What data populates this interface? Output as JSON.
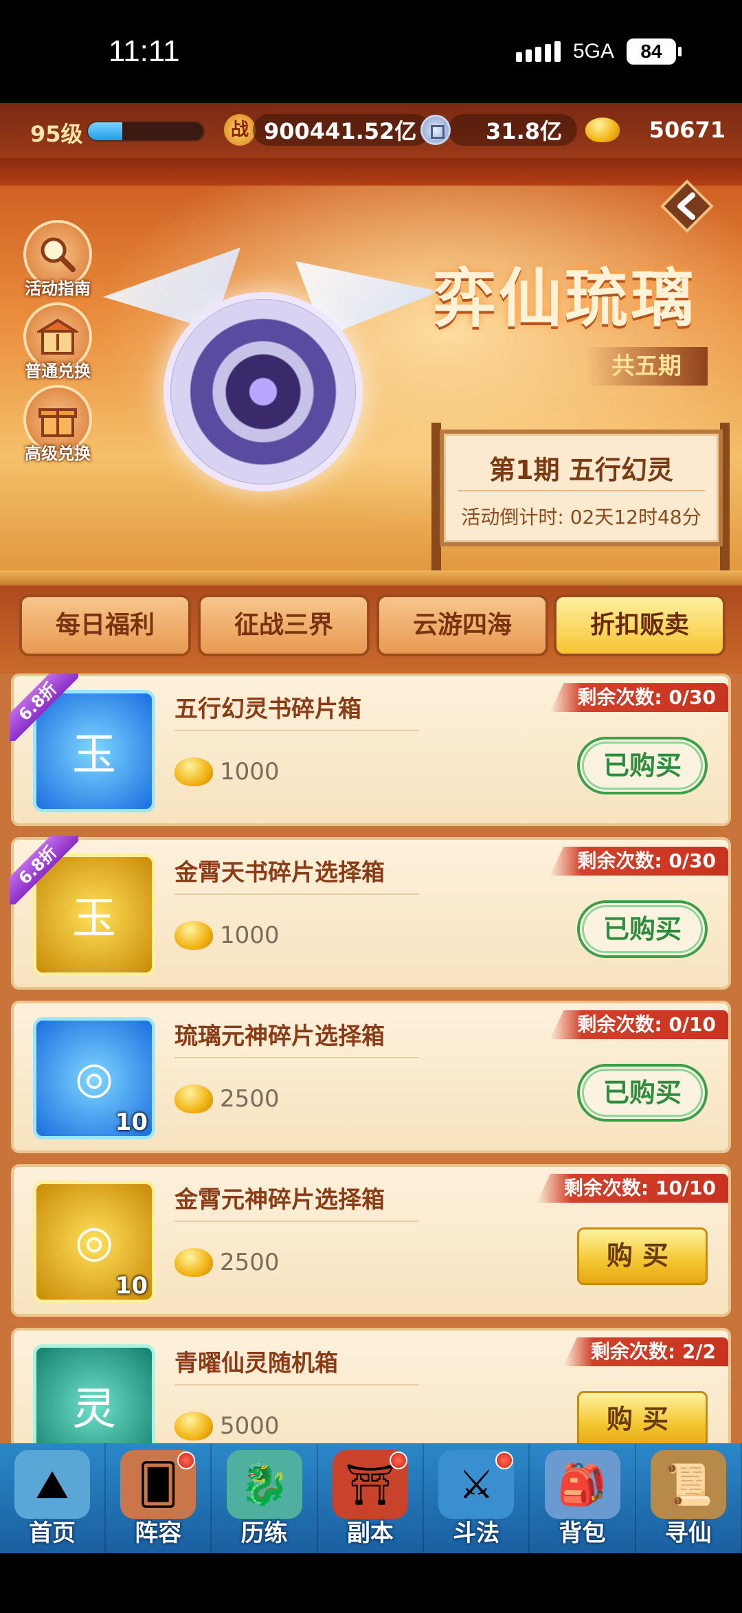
{
  "status": {
    "time": "11:11",
    "network": "5GA",
    "battery": "84"
  },
  "resources": {
    "level": "95级",
    "xp_fraction": 0.3,
    "combat_icon": "战",
    "combat_power": "900441.52亿",
    "silver": "31.8亿",
    "gold": "50671"
  },
  "banner": {
    "title": "弈仙琉璃",
    "subtitle": "共五期",
    "side_buttons": [
      {
        "label": "活动指南",
        "icon": "magnifier-icon"
      },
      {
        "label": "普通兑换",
        "icon": "shop-icon"
      },
      {
        "label": "高级兑换",
        "icon": "gift-icon"
      }
    ],
    "notice": {
      "title": "第1期  五行幻灵",
      "countdown": "活动倒计时: 02天12时48分"
    }
  },
  "tabs": [
    {
      "label": "每日福利",
      "active": false
    },
    {
      "label": "征战三界",
      "active": false
    },
    {
      "label": "云游四海",
      "active": false
    },
    {
      "label": "折扣贩卖",
      "active": true
    }
  ],
  "items": [
    {
      "name": "五行幻灵书碎片箱",
      "price": "1000",
      "remaining": "剩余次数: 0/30",
      "button": "已购买",
      "purchased": true,
      "discount": "6.8折",
      "count": "",
      "color": "blue",
      "glyph": "玉"
    },
    {
      "name": "金霄天书碎片选择箱",
      "price": "1000",
      "remaining": "剩余次数: 0/30",
      "button": "已购买",
      "purchased": true,
      "discount": "6.8折",
      "count": "",
      "color": "gold",
      "glyph": "玉"
    },
    {
      "name": "琉璃元神碎片选择箱",
      "price": "2500",
      "remaining": "剩余次数: 0/10",
      "button": "已购买",
      "purchased": true,
      "discount": "",
      "count": "10",
      "color": "blue",
      "glyph": "◎"
    },
    {
      "name": "金霄元神碎片选择箱",
      "price": "2500",
      "remaining": "剩余次数: 10/10",
      "button": "购买",
      "purchased": false,
      "discount": "",
      "count": "10",
      "color": "gold",
      "glyph": "◎"
    },
    {
      "name": "青曜仙灵随机箱",
      "price": "5000",
      "remaining": "剩余次数: 2/2",
      "button": "购买",
      "purchased": false,
      "discount": "",
      "count": "",
      "color": "teal",
      "glyph": "灵"
    }
  ],
  "nav": [
    {
      "label": "首页",
      "icon": "home-mountain-icon",
      "badge": false
    },
    {
      "label": "阵容",
      "icon": "cards-icon",
      "badge": true
    },
    {
      "label": "历练",
      "icon": "dragon-icon",
      "badge": false
    },
    {
      "label": "副本",
      "icon": "gate-icon",
      "badge": true
    },
    {
      "label": "斗法",
      "icon": "crossed-swords-icon",
      "badge": true
    },
    {
      "label": "背包",
      "icon": "bag-icon",
      "badge": false
    },
    {
      "label": "寻仙",
      "icon": "scroll-icon",
      "badge": false
    }
  ]
}
